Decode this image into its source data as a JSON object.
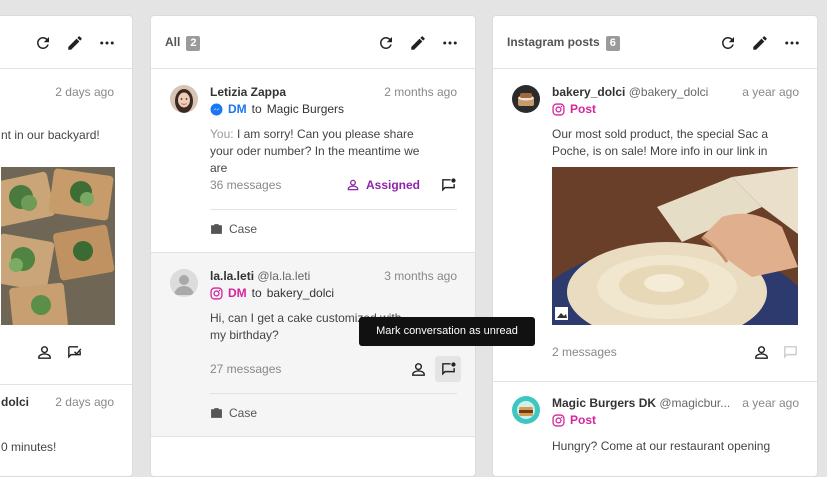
{
  "left_column": {
    "card1": {
      "time": "2 days ago",
      "text": "nt in our backyard!"
    },
    "card2": {
      "name": "dolci",
      "time": "2 days ago",
      "text": "0 minutes!"
    }
  },
  "middle_column": {
    "title": "All",
    "count": "2",
    "conversations": [
      {
        "name": "Letizia Zappa",
        "time": "2 months ago",
        "type": "DM",
        "to_prefix": "to",
        "to": "Magic Burgers",
        "you_prefix": "You:",
        "preview": "I am sorry! Can you please share your oder number? In the meantime we are",
        "messages": "36 messages",
        "status": "Assigned",
        "case": "Case"
      },
      {
        "name": "la.la.leti",
        "handle": "@la.la.leti",
        "time": "3 months ago",
        "type": "DM",
        "to_prefix": "to",
        "to": "bakery_dolci",
        "preview": "Hi, can I get a cake customized with my birthday?",
        "messages": "27 messages",
        "case": "Case"
      }
    ],
    "tooltip": "Mark conversation as unread"
  },
  "right_column": {
    "title": "Instagram posts",
    "count": "6",
    "posts": [
      {
        "name": "bakery_dolci",
        "handle": "@bakery_dolci",
        "time": "a year ago",
        "type": "Post",
        "text": "Our most sold product, the special Sac a Poche, is on sale! More info in our link in",
        "messages": "2 messages"
      },
      {
        "name": "Magic Burgers DK",
        "handle": "@magicbur...",
        "time": "a year ago",
        "type": "Post",
        "text": "Hungry? Come at our restaurant opening"
      }
    ]
  },
  "icons": {
    "refresh": "refresh-icon",
    "edit": "pencil-icon",
    "more": "more-horizontal-icon",
    "messenger": "facebook-messenger-icon",
    "instagram": "instagram-icon",
    "assign": "person-icon",
    "unread": "chat-unread-icon",
    "case": "briefcase-icon",
    "image": "image-icon"
  },
  "colors": {
    "assigned": "#8e24aa",
    "facebook": "#1877f2",
    "instagram": "#d6249f"
  }
}
